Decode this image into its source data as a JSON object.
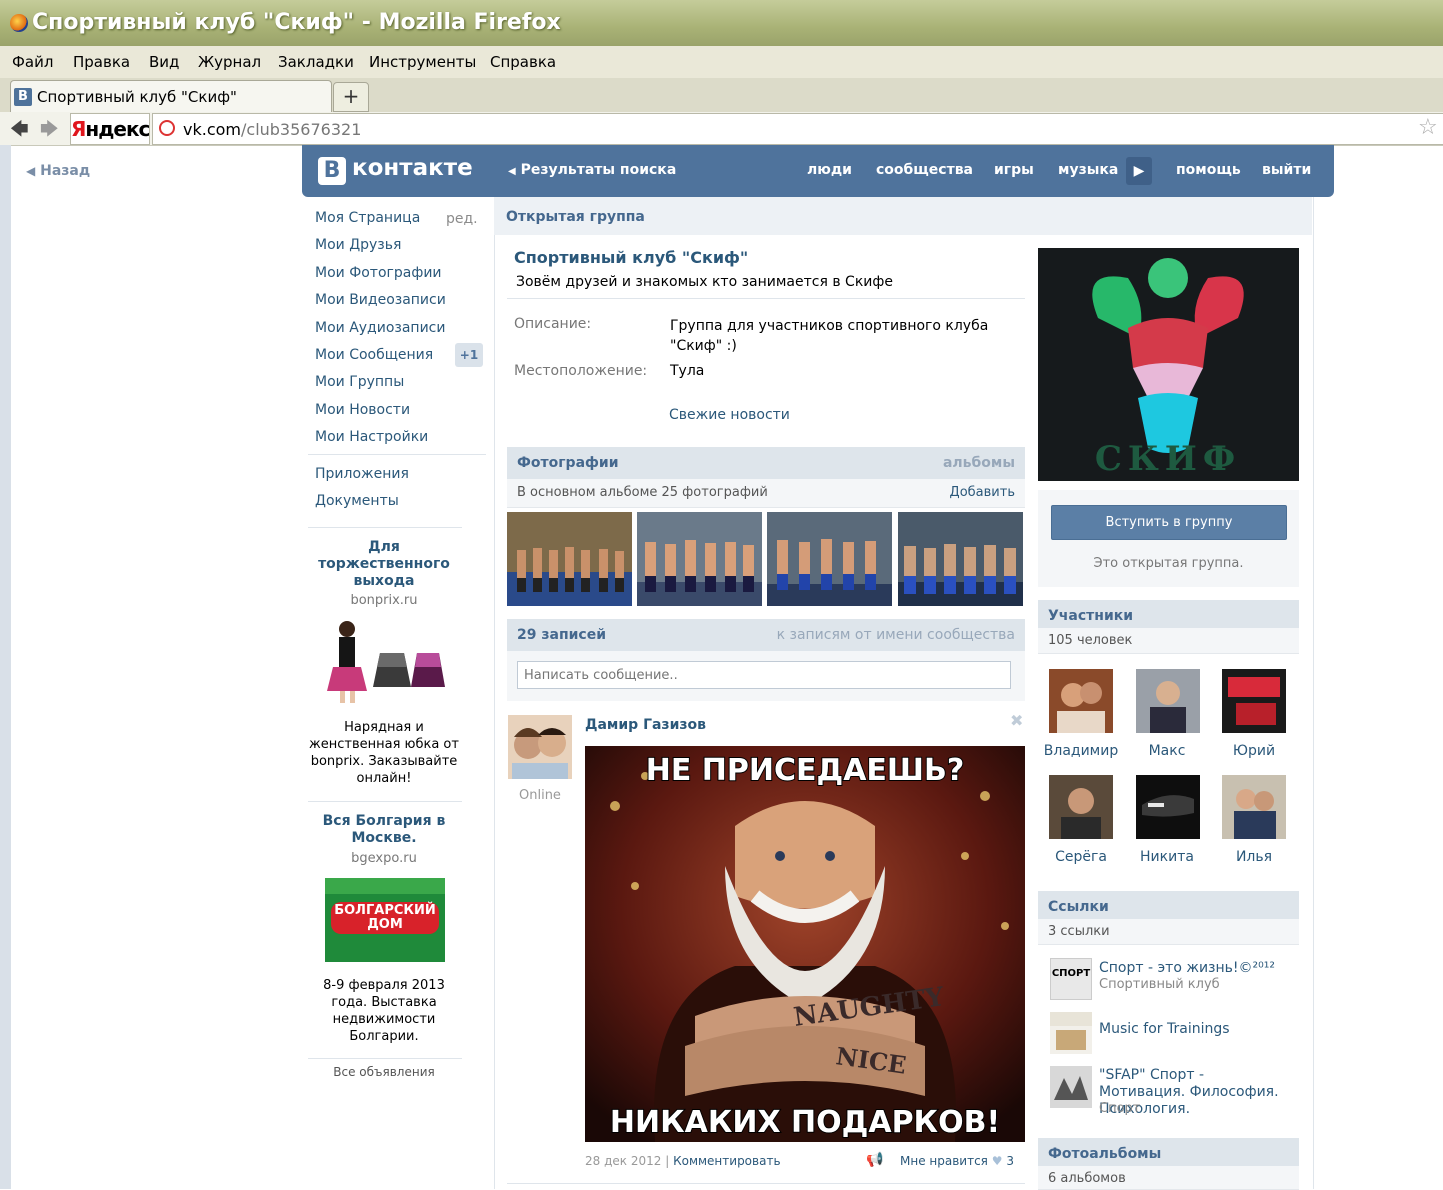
{
  "browser": {
    "window_title": "Спортивный клуб \"Скиф\" - Mozilla Firefox",
    "menu": [
      "Файл",
      "Правка",
      "Вид",
      "Журнал",
      "Закладки",
      "Инструменты",
      "Справка"
    ],
    "tab_label": "Спортивный клуб \"Скиф\"",
    "tab_icon_letter": "В",
    "new_tab": "+",
    "yandex_y": "Я",
    "yandex_rest": "ндекс",
    "url_host": "vk.com",
    "url_path": "/club35676321",
    "icons": [
      "back-icon",
      "forward-icon",
      "site-icon",
      "bookmark-star-icon"
    ]
  },
  "page": {
    "back_link": "Назад",
    "header": {
      "logo_letter": "В",
      "logo_text": "контакте",
      "search_results": "Результаты поиска",
      "links": [
        "люди",
        "сообщества",
        "игры",
        "музыка",
        "помощь",
        "выйти"
      ],
      "accent": "#4f739c"
    },
    "left_menu": {
      "items": [
        "Моя Страница",
        "Мои Друзья",
        "Мои Фотографии",
        "Мои Видеозаписи",
        "Мои Аудиозаписи",
        "Мои Сообщения",
        "Мои Группы",
        "Мои Новости",
        "Мои Настройки"
      ],
      "edit": "ред.",
      "messages_badge": "+1",
      "extra": [
        "Приложения",
        "Документы"
      ]
    },
    "ads": [
      {
        "title": "Для торжественного выхода",
        "domain": "bonprix.ru",
        "text": "Нарядная и женственная юбка от bonprix. Заказывайте онлайн!"
      },
      {
        "title": "Вся Болгария в Москве.",
        "domain": "bgexpo.ru",
        "image_text": "БОЛГАРСКИЙ ДОМ",
        "text": "8-9 февраля 2013 года. Выставка недвижимости Болгарии."
      }
    ],
    "all_ads": "Все объявления",
    "group": {
      "type_label": "Открытая группа",
      "name": "Спортивный клуб \"Скиф\"",
      "status": "Зовём друзей и знакомых кто занимается в Скифе",
      "desc_label": "Описание:",
      "desc_value": "Группа для участников спортивного клуба \"Скиф\" :)",
      "loc_label": "Местоположение:",
      "loc_value": "Тула",
      "fresh_news": "Свежие новости"
    },
    "photos": {
      "title": "Фотографии",
      "albums_link": "альбомы",
      "subtitle": "В основном альбоме 25 фотографий",
      "add": "Добавить"
    },
    "wall": {
      "count": "29 записей",
      "community_link": "к записям от имени сообщества",
      "placeholder": "Написать сообщение..",
      "post": {
        "author": "Дамир Газизов",
        "online": "Online",
        "meme_top": "НЕ ПРИСЕДАЕШЬ?",
        "meme_bottom": "НИКАКИХ ПОДАРКОВ!",
        "meme_tattoo_1": "NAUGHTY",
        "meme_tattoo_2": "NICE",
        "date": "28 дек 2012",
        "separator": "|",
        "comment": "Комментировать",
        "like": "Мне нравится",
        "likes": "3"
      }
    },
    "right": {
      "logo_text": "СКИФ",
      "join_button": "Вступить в группу",
      "open_note": "Это открытая группа.",
      "members_title": "Участники",
      "members_count": "105 человек",
      "members": [
        "Владимир",
        "Макс",
        "Юрий",
        "Серёга",
        "Никита",
        "Илья"
      ],
      "links_title": "Ссылки",
      "links_count": "3 ссылки",
      "links": [
        {
          "name": "Спорт - это жизнь!©²⁰¹²",
          "sub": "Спортивный клуб",
          "icon_text": "СПОРТ"
        },
        {
          "name": "Music for Trainings",
          "sub": ""
        },
        {
          "name": "\"SFAP\" Спорт - Мотивация. Философия. Психология.",
          "sub": "Спорт"
        }
      ],
      "albums_title": "Фотоальбомы",
      "albums_count": "6 альбомов"
    }
  }
}
